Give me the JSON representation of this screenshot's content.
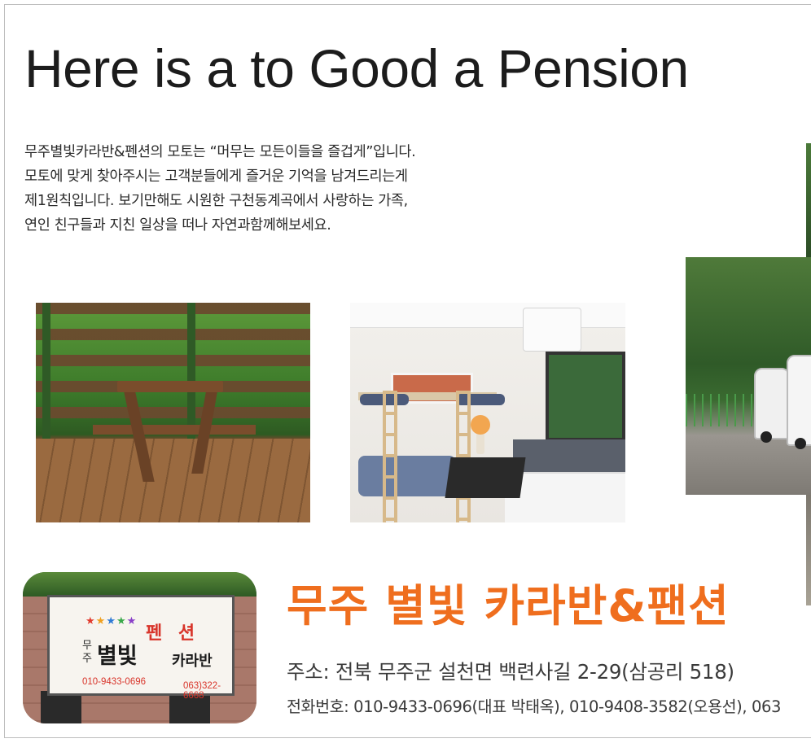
{
  "headline": "Here is a to Good a Pension",
  "intro_lines": [
    "무주별빛카라반&펜션의 모토는 “머무는 모든이들을 즐겁게”입니다.",
    "모토에 맞게 찾아주시는 고객분들에게 즐거운 기억을 남겨드리는게",
    "제1원칙입니다. 보기만해도 시원한 구천동계곡에서 사랑하는 가족,",
    "연인 친구들과 지친 일상을 떠나 자연과함께해보세요."
  ],
  "sign": {
    "pension": "펜 션",
    "muju": "무주",
    "byeolbit": "별빛",
    "caravan": "카라반",
    "phone_mobile": "010-9433-0696",
    "phone_local": "063)322-6668",
    "star_colors": [
      "#e23b2e",
      "#f0a020",
      "#2f7ad6",
      "#3aa84a",
      "#8a3fc8"
    ]
  },
  "brand_name": "무주 별빛 카라반&팬션",
  "address": "주소: 전북 무주군 설천면 백련사길 2-29(삼공리 518)",
  "telephone": "전화번호: 010-9433-0696(대표 박태옥), 010-9408-3582(오용선), 063",
  "colors": {
    "brand_orange": "#ef6e1e",
    "sign_red": "#d8342a"
  }
}
